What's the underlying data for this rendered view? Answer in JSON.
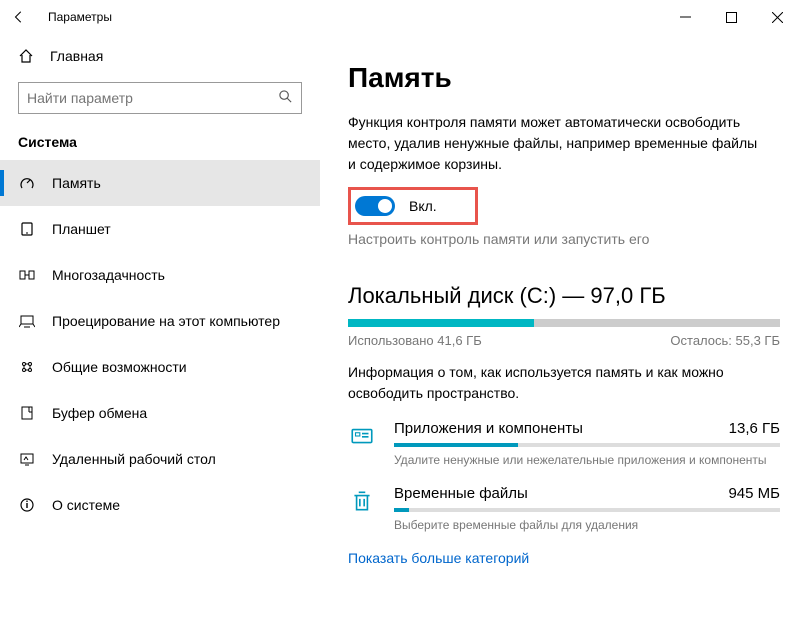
{
  "window": {
    "title": "Параметры"
  },
  "sidebar": {
    "home": "Главная",
    "search_placeholder": "Найти параметр",
    "category": "Система",
    "items": [
      {
        "label": "Память",
        "active": true
      },
      {
        "label": "Планшет"
      },
      {
        "label": "Многозадачность"
      },
      {
        "label": "Проецирование на этот компьютер"
      },
      {
        "label": "Общие возможности"
      },
      {
        "label": "Буфер обмена"
      },
      {
        "label": "Удаленный рабочий стол"
      },
      {
        "label": "О системе"
      }
    ]
  },
  "main": {
    "heading": "Память",
    "description": "Функция контроля памяти может автоматически освободить место, удалив ненужные файлы, например временные файлы и содержимое корзины.",
    "toggle_label": "Вкл.",
    "toggle_on": true,
    "configure_link": "Настроить контроль памяти или запустить его",
    "disk": {
      "title": "Локальный диск (C:) — 97,0 ГБ",
      "used_label": "Использовано 41,6 ГБ",
      "free_label": "Осталось: 55,3 ГБ",
      "fill_percent": 43,
      "info": "Информация о том, как используется память и как можно освободить пространство."
    },
    "categories": [
      {
        "name": "Приложения и компоненты",
        "size": "13,6 ГБ",
        "hint": "Удалите ненужные или нежелательные приложения и компоненты",
        "fill": 32
      },
      {
        "name": "Временные файлы",
        "size": "945 МБ",
        "hint": "Выберите временные файлы для удаления",
        "fill": 4
      }
    ],
    "show_more": "Показать больше категорий"
  }
}
